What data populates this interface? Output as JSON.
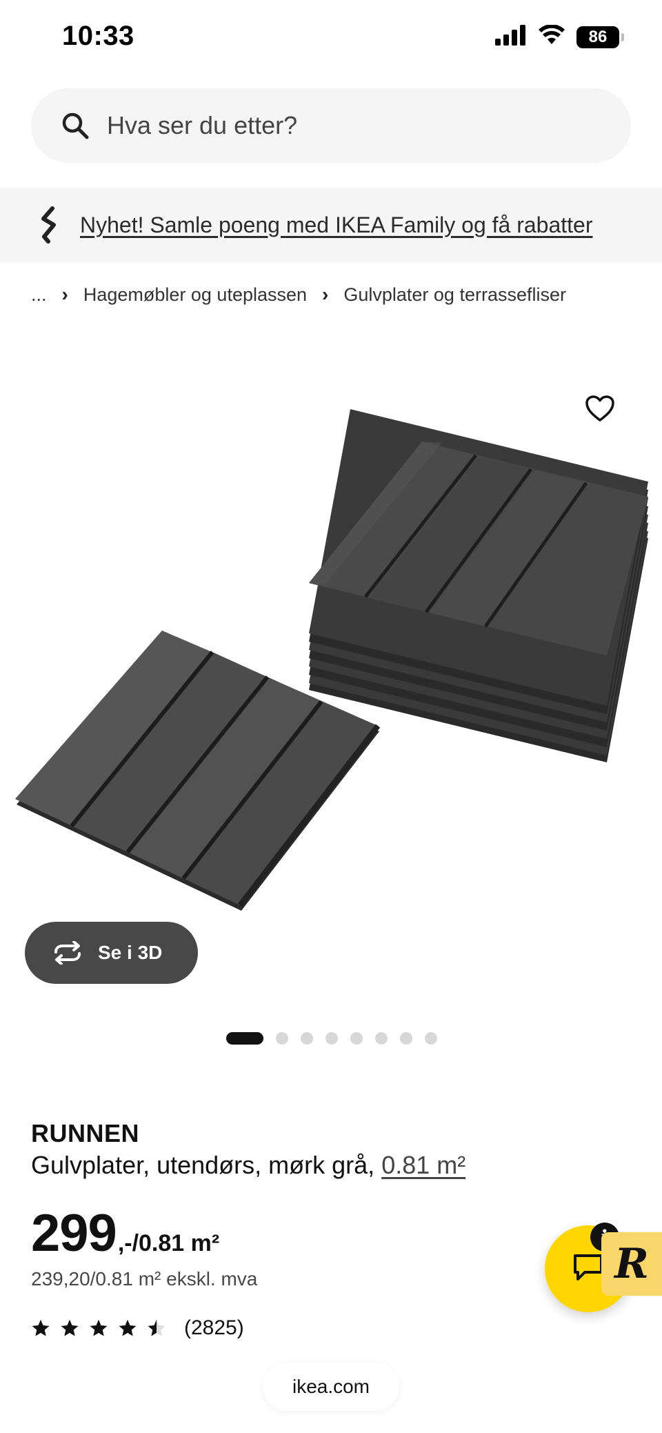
{
  "status_bar": {
    "time": "10:33",
    "battery": "86",
    "icons": [
      "signal-icon",
      "wifi-icon",
      "battery-icon"
    ]
  },
  "search": {
    "placeholder": "Hva ser du etter?",
    "icon": "search-icon"
  },
  "promo": {
    "text": "Nyhet! Samle poeng med IKEA Family og få rabatter",
    "icon": "ikea-family-icon"
  },
  "breadcrumb": {
    "ellipsis": "...",
    "items": [
      "Hagemøbler og uteplassen",
      "Gulvplater og terrassefliser"
    ]
  },
  "gallery": {
    "view_3d_label": "Se i 3D",
    "image_count": 8,
    "active_index": 0,
    "favourite_icon": "heart-icon"
  },
  "product": {
    "name": "RUNNEN",
    "description": "Gulvplater, utendørs, mørk grå,",
    "size": "0.81 m²",
    "price_integer": "299",
    "price_suffix": ",-/0.81 m²",
    "price_ex_vat": "239,20/0.81 m² ekskl. mva",
    "rating": 4.5,
    "rating_max": 5,
    "review_count": "(2825)"
  },
  "chat": {
    "icon": "chat-icon",
    "info_label": "i",
    "r_label": "R"
  },
  "url": "ikea.com",
  "colors": {
    "accent_yellow": "#ffd600",
    "pill_dark": "#484848",
    "surface_gray": "#f5f5f5"
  }
}
